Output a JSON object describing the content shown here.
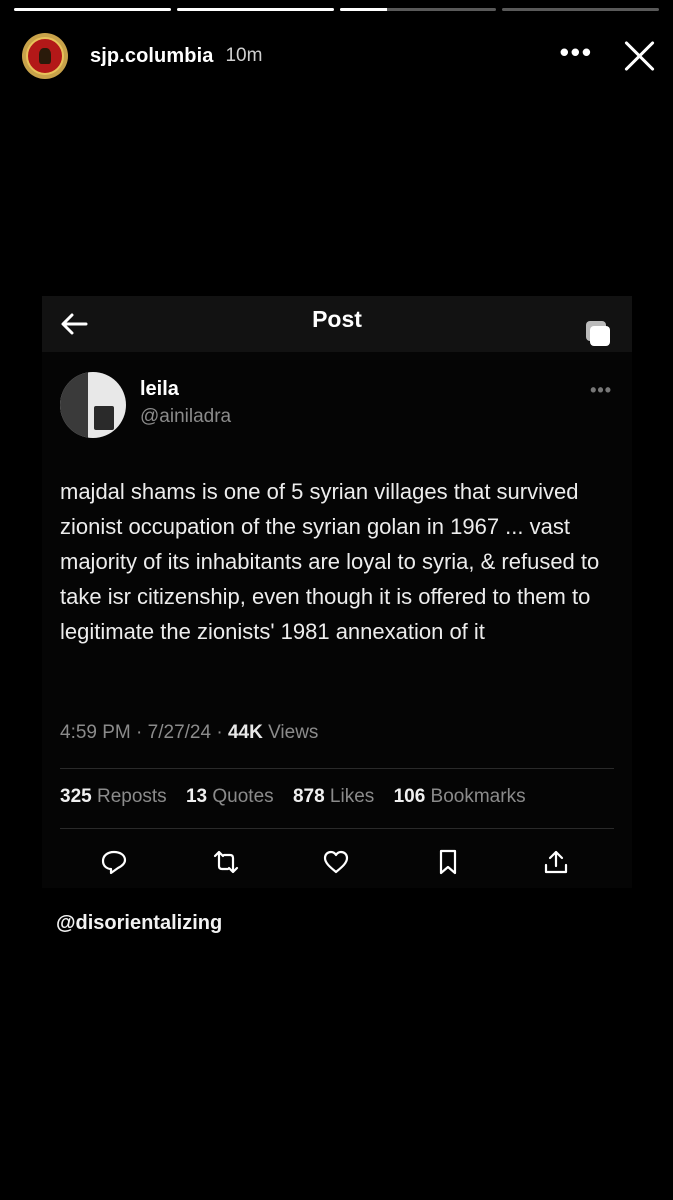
{
  "story": {
    "progress": [
      1,
      1,
      0.3,
      0,
      0
    ],
    "username": "sjp.columbia",
    "time_ago": "10m",
    "more_label": "•••",
    "mention": "@disorientalizing"
  },
  "post": {
    "header_title": "Post",
    "author_name": "leila",
    "author_handle": "@ainiladra",
    "more_label": "•••",
    "text": "majdal shams is one of 5 syrian villages that survived zionist occupation of the syrian golan in 1967 ... vast majority of its inhabitants are loyal to syria, & refused to take isr citizenship, even though it is offered to them to legitimate the zionists' 1981 annexation of it",
    "time": "4:59 PM",
    "date": "7/27/24",
    "separator": "·",
    "views_count": "44K",
    "views_label": "Views",
    "stats": [
      {
        "count": "325",
        "label": "Reposts"
      },
      {
        "count": "13",
        "label": "Quotes"
      },
      {
        "count": "878",
        "label": "Likes"
      },
      {
        "count": "106",
        "label": "Bookmarks"
      }
    ],
    "actions": [
      "reply-icon",
      "repost-icon",
      "like-icon",
      "bookmark-icon",
      "share-icon"
    ]
  }
}
